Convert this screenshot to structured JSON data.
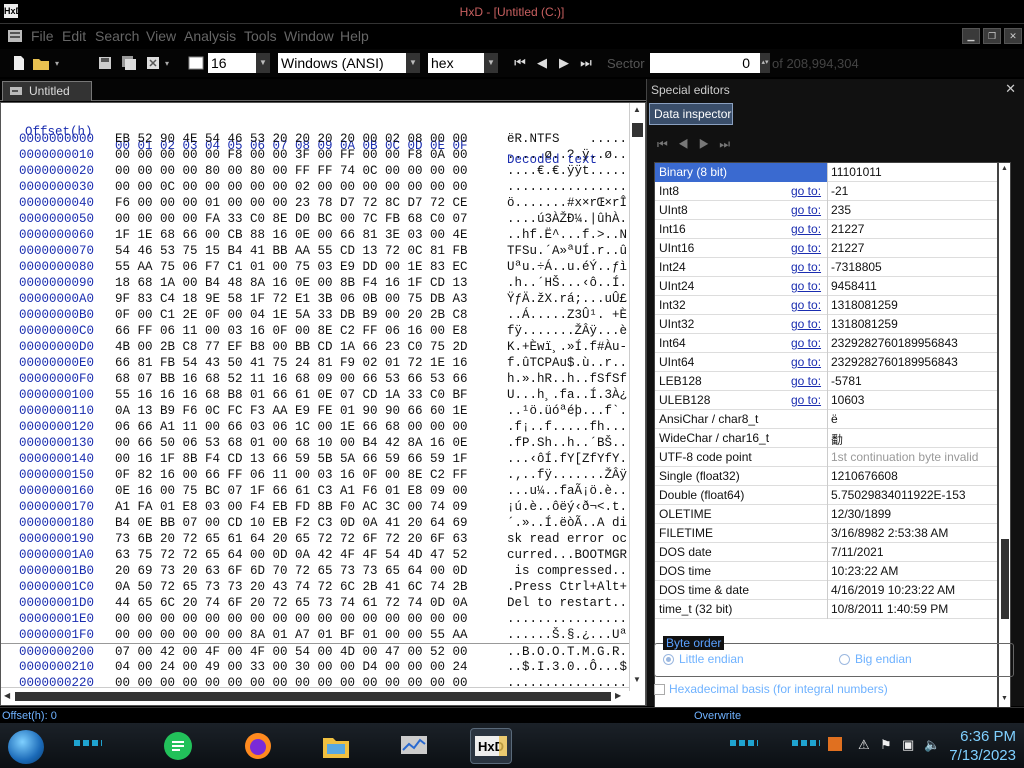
{
  "window": {
    "title": "HxD - [Untitled (C:)]",
    "app_icon": "HxD"
  },
  "menu": [
    "File",
    "Edit",
    "Search",
    "View",
    "Analysis",
    "Tools",
    "Window",
    "Help"
  ],
  "toolbar": {
    "bytes_per_row": "16",
    "charset": "Windows (ANSI)",
    "display_mode": "hex",
    "sector_label": "Sector",
    "sector_value": "0",
    "sector_total": "of 208,994,304"
  },
  "tab": {
    "label": "Untitled (C:)"
  },
  "hex_header": {
    "offset_label": "Offset(h)",
    "columns": [
      "00",
      "01",
      "02",
      "03",
      "04",
      "05",
      "06",
      "07",
      "08",
      "09",
      "0A",
      "0B",
      "0C",
      "0D",
      "0E",
      "0F"
    ],
    "decoded_label": "Decoded text"
  },
  "hex_rows": [
    {
      "offset": "0000000000",
      "hex": "EB 52 90 4E 54 46 53 20 20 20 20 00 02 08 00 00",
      "text": "ëR.NTFS    ....."
    },
    {
      "offset": "0000000010",
      "hex": "00 00 00 00 00 F8 00 00 3F 00 FF 00 00 F8 0A 00",
      "text": ".....ø..?.ÿ..ø.."
    },
    {
      "offset": "0000000020",
      "hex": "00 00 00 00 80 00 80 00 FF FF 74 0C 00 00 00 00",
      "text": "....€.€.ÿÿt....."
    },
    {
      "offset": "0000000030",
      "hex": "00 00 0C 00 00 00 00 00 02 00 00 00 00 00 00 00",
      "text": "................"
    },
    {
      "offset": "0000000040",
      "hex": "F6 00 00 00 01 00 00 00 23 78 D7 72 8C D7 72 CE",
      "text": "ö.......#x×rŒ×rÎ"
    },
    {
      "offset": "0000000050",
      "hex": "00 00 00 00 FA 33 C0 8E D0 BC 00 7C FB 68 C0 07",
      "text": "....ú3ÀŽĐ¼.|ûhÀ."
    },
    {
      "offset": "0000000060",
      "hex": "1F 1E 68 66 00 CB 88 16 0E 00 66 81 3E 03 00 4E",
      "text": "..hf.Ë^...f.>..N"
    },
    {
      "offset": "0000000070",
      "hex": "54 46 53 75 15 B4 41 BB AA 55 CD 13 72 0C 81 FB",
      "text": "TFSu.´A»ªUÍ.r..û"
    },
    {
      "offset": "0000000080",
      "hex": "55 AA 75 06 F7 C1 01 00 75 03 E9 DD 00 1E 83 EC",
      "text": "Uªu.÷Á..u.éÝ..ƒì"
    },
    {
      "offset": "0000000090",
      "hex": "18 68 1A 00 B4 48 8A 16 0E 00 8B F4 16 1F CD 13",
      "text": ".h..´HŠ...‹ô..Í."
    },
    {
      "offset": "00000000A0",
      "hex": "9F 83 C4 18 9E 58 1F 72 E1 3B 06 0B 00 75 DB A3",
      "text": "ŸƒÄ.žX.rá;...uÛ£"
    },
    {
      "offset": "00000000B0",
      "hex": "0F 00 C1 2E 0F 00 04 1E 5A 33 DB B9 00 20 2B C8",
      "text": "..Á.....Z3Û¹. +È"
    },
    {
      "offset": "00000000C0",
      "hex": "66 FF 06 11 00 03 16 0F 00 8E C2 FF 06 16 00 E8",
      "text": "fÿ.......ŽÂÿ...è"
    },
    {
      "offset": "00000000D0",
      "hex": "4B 00 2B C8 77 EF B8 00 BB CD 1A 66 23 C0 75 2D",
      "text": "K.+Èwï¸.»Í.f#Àu-"
    },
    {
      "offset": "00000000E0",
      "hex": "66 81 FB 54 43 50 41 75 24 81 F9 02 01 72 1E 16",
      "text": "f.ûTCPAu$.ù..r.."
    },
    {
      "offset": "00000000F0",
      "hex": "68 07 BB 16 68 52 11 16 68 09 00 66 53 66 53 66",
      "text": "h.».hR..h..fSfSf"
    },
    {
      "offset": "0000000100",
      "hex": "55 16 16 16 68 B8 01 66 61 0E 07 CD 1A 33 C0 BF",
      "text": "U...h¸.fa..Í.3À¿"
    },
    {
      "offset": "0000000110",
      "hex": "0A 13 B9 F6 0C FC F3 AA E9 FE 01 90 90 66 60 1E",
      "text": "..¹ö.üóªéþ...f`."
    },
    {
      "offset": "0000000120",
      "hex": "06 66 A1 11 00 66 03 06 1C 00 1E 66 68 00 00 00",
      "text": ".f¡..f.....fh..."
    },
    {
      "offset": "0000000130",
      "hex": "00 66 50 06 53 68 01 00 68 10 00 B4 42 8A 16 0E",
      "text": ".fP.Sh..h..´BŠ.."
    },
    {
      "offset": "0000000140",
      "hex": "00 16 1F 8B F4 CD 13 66 59 5B 5A 66 59 66 59 1F",
      "text": "...‹ôÍ.fY[ZfYfY."
    },
    {
      "offset": "0000000150",
      "hex": "0F 82 16 00 66 FF 06 11 00 03 16 0F 00 8E C2 FF",
      "text": ".‚..fÿ.......ŽÂÿ"
    },
    {
      "offset": "0000000160",
      "hex": "0E 16 00 75 BC 07 1F 66 61 C3 A1 F6 01 E8 09 00",
      "text": "...u¼..faÃ¡ö.è.."
    },
    {
      "offset": "0000000170",
      "hex": "A1 FA 01 E8 03 00 F4 EB FD 8B F0 AC 3C 00 74 09",
      "text": "¡ú.è..ôëý‹ð¬<.t."
    },
    {
      "offset": "0000000180",
      "hex": "B4 0E BB 07 00 CD 10 EB F2 C3 0D 0A 41 20 64 69",
      "text": "´.»..Í.ëòÃ..A di"
    },
    {
      "offset": "0000000190",
      "hex": "73 6B 20 72 65 61 64 20 65 72 72 6F 72 20 6F 63",
      "text": "sk read error oc"
    },
    {
      "offset": "00000001A0",
      "hex": "63 75 72 72 65 64 00 0D 0A 42 4F 4F 54 4D 47 52",
      "text": "curred...BOOTMGR"
    },
    {
      "offset": "00000001B0",
      "hex": "20 69 73 20 63 6F 6D 70 72 65 73 73 65 64 00 0D",
      "text": " is compressed.."
    },
    {
      "offset": "00000001C0",
      "hex": "0A 50 72 65 73 73 20 43 74 72 6C 2B 41 6C 74 2B",
      "text": ".Press Ctrl+Alt+"
    },
    {
      "offset": "00000001D0",
      "hex": "44 65 6C 20 74 6F 20 72 65 73 74 61 72 74 0D 0A",
      "text": "Del to restart.."
    },
    {
      "offset": "00000001E0",
      "hex": "00 00 00 00 00 00 00 00 00 00 00 00 00 00 00 00",
      "text": "................"
    },
    {
      "offset": "00000001F0",
      "hex": "00 00 00 00 00 00 8A 01 A7 01 BF 01 00 00 55 AA",
      "text": "......Š.§.¿...Uª"
    },
    {
      "offset": "0000000200",
      "hex": "07 00 42 00 4F 00 4F 00 54 00 4D 00 47 00 52 00",
      "text": "..B.O.O.T.M.G.R."
    },
    {
      "offset": "0000000210",
      "hex": "04 00 24 00 49 00 33 00 30 00 00 D4 00 00 00 24",
      "text": "..$.I.3.0..Ô...$"
    },
    {
      "offset": "0000000220",
      "hex": "00 00 00 00 00 00 00 00 00 00 00 00 00 00 00 00",
      "text": "................"
    }
  ],
  "special_editors": {
    "title": "Special editors",
    "tab": "Data inspector"
  },
  "inspector_rows": [
    {
      "label": "Binary (8 bit)",
      "value": "11101011",
      "goto": false
    },
    {
      "label": "Int8",
      "value": "-21",
      "goto": true
    },
    {
      "label": "UInt8",
      "value": "235",
      "goto": true
    },
    {
      "label": "Int16",
      "value": "21227",
      "goto": true
    },
    {
      "label": "UInt16",
      "value": "21227",
      "goto": true
    },
    {
      "label": "Int24",
      "value": "-7318805",
      "goto": true
    },
    {
      "label": "UInt24",
      "value": "9458411",
      "goto": true
    },
    {
      "label": "Int32",
      "value": "1318081259",
      "goto": true
    },
    {
      "label": "UInt32",
      "value": "1318081259",
      "goto": true
    },
    {
      "label": "Int64",
      "value": "2329282760189956843",
      "goto": true
    },
    {
      "label": "UInt64",
      "value": "2329282760189956843",
      "goto": true
    },
    {
      "label": "LEB128",
      "value": "-5781",
      "goto": true
    },
    {
      "label": "ULEB128",
      "value": "10603",
      "goto": true
    },
    {
      "label": "AnsiChar / char8_t",
      "value": "ë",
      "goto": false
    },
    {
      "label": "WideChar / char16_t",
      "value": "勫",
      "goto": false
    },
    {
      "label": "UTF-8 code point",
      "value": "1st continuation byte invalid",
      "goto": false,
      "muted": true
    },
    {
      "label": "Single (float32)",
      "value": "1210676608",
      "goto": false
    },
    {
      "label": "Double (float64)",
      "value": "5.75029834011922E-153",
      "goto": false
    },
    {
      "label": "OLETIME",
      "value": "12/30/1899",
      "goto": false
    },
    {
      "label": "FILETIME",
      "value": "3/16/8982 2:53:38 AM",
      "goto": false
    },
    {
      "label": "DOS date",
      "value": "7/11/2021",
      "goto": false
    },
    {
      "label": "DOS time",
      "value": "10:23:22 AM",
      "goto": false
    },
    {
      "label": "DOS time & date",
      "value": "4/16/2019 10:23:22 AM",
      "goto": false
    },
    {
      "label": "time_t (32 bit)",
      "value": "10/8/2011 1:40:59 PM",
      "goto": false
    }
  ],
  "goto_label": "go to:",
  "byte_order": {
    "legend": "Byte order",
    "little": "Little endian",
    "big": "Big endian",
    "selected": "little"
  },
  "hex_basis": "Hexadecimal basis (for integral numbers)",
  "status": {
    "offset": "Offset(h): 0",
    "mode": "Overwrite"
  },
  "clock": {
    "time": "6:36 PM",
    "date": "7/13/2023"
  },
  "colors": {
    "selection": "#3a6ad0",
    "offset_blue": "#1a2db0",
    "clock": "#7fd0ff"
  }
}
